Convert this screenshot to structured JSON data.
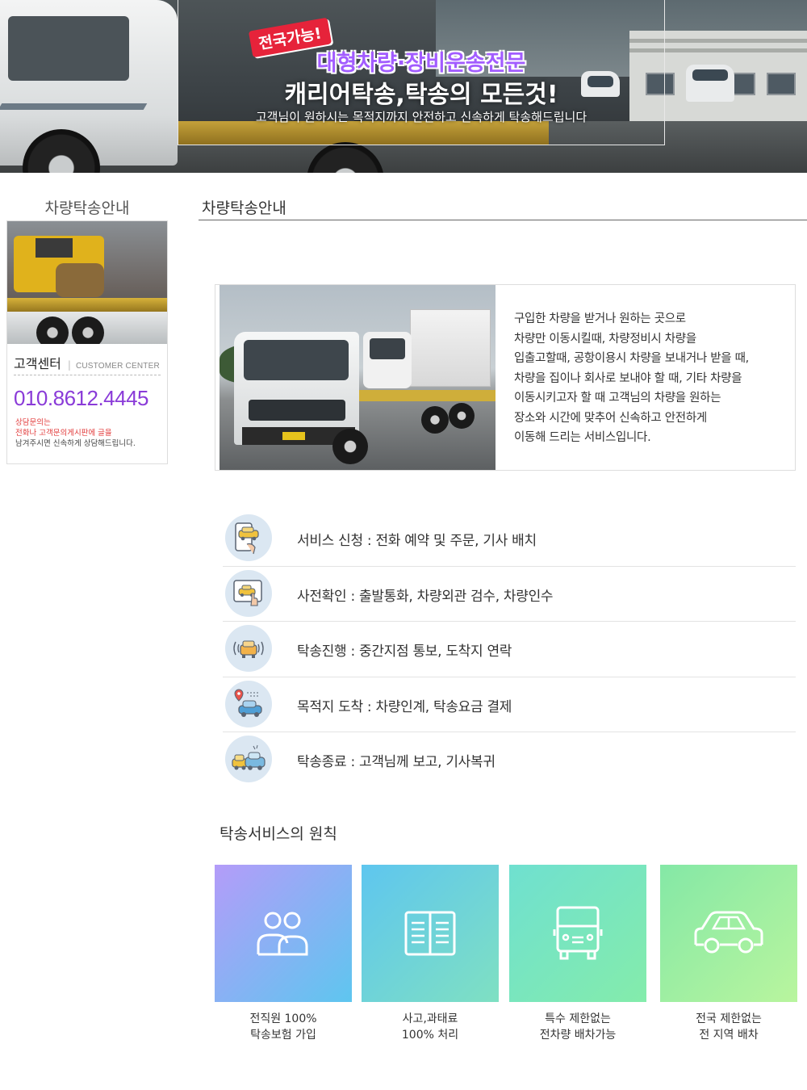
{
  "hero": {
    "badge": "전국가능!",
    "headline1": "대형차량·장비운송전문",
    "headline2": "캐리어탁송,탁송의 모든것!",
    "tagline": "고객님이 원하시는 목적지까지 안전하고 신속하게 탁송해드립니다"
  },
  "sidebar": {
    "title": "차량탁송안내",
    "cs_title": "고객센터",
    "cs_sub": "CUSTOMER CENTER",
    "phone": "010.8612.4445",
    "note_red": "상담문의는\n전화나 고객문의게시판에 글을",
    "note_dark": "남겨주시면 신속하게 상담해드립니다."
  },
  "main": {
    "title": "차량탁송안내",
    "intro": "구입한 차량을 받거나 원하는 곳으로\n차량만 이동시킬때, 차량정비시 차량을\n입출고할때, 공항이용시 차량을 보내거나 받을 때,\n차량을 집이나 회사로 보내야 할 때, 기타 차량을\n이동시키고자 할 때  고객님의 차량을 원하는\n장소와 시간에 맞추어 신속하고 안전하게\n이동해 드리는 서비스입니다."
  },
  "steps": [
    {
      "icon": "phone-car-icon",
      "text": "서비스 신청 : 전화 예약 및 주문, 기사 배치"
    },
    {
      "icon": "tablet-check-icon",
      "text": "사전확인 : 출발통화, 차량외관 검수, 차량인수"
    },
    {
      "icon": "car-signal-icon",
      "text": "탁송진행 : 중간지점 통보, 도착지 연락"
    },
    {
      "icon": "location-car-icon",
      "text": "목적지 도착 : 차량인계, 탁송요금 결제"
    },
    {
      "icon": "two-cars-icon",
      "text": "탁송종료 : 고객님께 보고, 기사복귀"
    }
  ],
  "principles": {
    "title": "탁송서비스의 원칙",
    "cards": [
      {
        "icon": "people-icon",
        "line1": "전직원 100%",
        "line2": "탁송보험 가입",
        "gradient": [
          "#b49cf9",
          "#5ec6ef"
        ]
      },
      {
        "icon": "book-icon",
        "line1": "사고,과태료",
        "line2": "100% 처리",
        "gradient": [
          "#5ec6ef",
          "#7fe0c2"
        ]
      },
      {
        "icon": "truck-icon",
        "line1": "특수 제한없는",
        "line2": "전차량 배차가능",
        "gradient": [
          "#6fe0d0",
          "#84ecab"
        ]
      },
      {
        "icon": "car-icon",
        "line1": "전국 제한없는",
        "line2": "전 지역 배차",
        "gradient": [
          "#84e8a6",
          "#b9f59e"
        ]
      }
    ]
  },
  "colors": {
    "accent_purple": "#8a3bd8",
    "badge_red": "#e6233a",
    "headline_purple": "#a25cff"
  }
}
